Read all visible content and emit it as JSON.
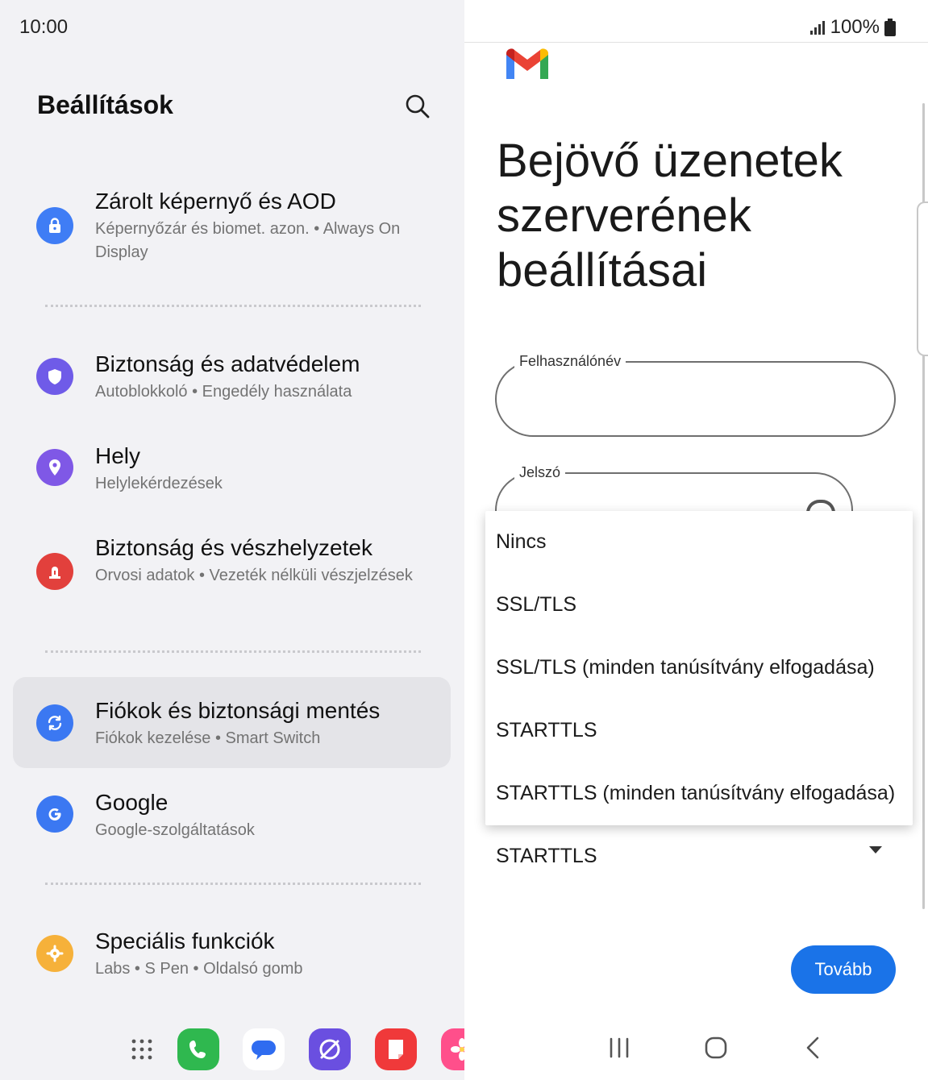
{
  "status_bar": {
    "time": "10:00",
    "battery": "100%"
  },
  "settings": {
    "title": "Beállítások",
    "items": [
      {
        "title": "Zárolt képernyő és AOD",
        "subtitle": "Képernyőzár és biomet. azon.  •  Always On Display",
        "icon": "lock-icon",
        "color": "#3f7df5"
      },
      {
        "title": "Biztonság és adatvédelem",
        "subtitle": "Autoblokkoló  •  Engedély használata",
        "icon": "shield-icon",
        "color": "#6f5be8"
      },
      {
        "title": "Hely",
        "subtitle": "Helylekérdezések",
        "icon": "location-pin-icon",
        "color": "#7f58e6"
      },
      {
        "title": "Biztonság és vészhelyzetek",
        "subtitle": "Orvosi adatok  •  Vezeték nélküli vészjelzések",
        "icon": "emergency-icon",
        "color": "#e2403c"
      },
      {
        "title": "Fiókok és biztonsági mentés",
        "subtitle": "Fiókok kezelése  •  Smart Switch",
        "icon": "sync-icon",
        "color": "#3b78f2"
      },
      {
        "title": "Google",
        "subtitle": "Google-szolgáltatások",
        "icon": "google-icon",
        "color": "#3b78f2"
      },
      {
        "title": "Speciális funkciók",
        "subtitle": "Labs  •  S Pen  •  Oldalsó gomb",
        "icon": "advanced-features-icon",
        "color": "#f6b13a"
      }
    ]
  },
  "gmail": {
    "heading": "Bejövő üzenetek szerverének beállításai",
    "username_label": "Felhasználónév",
    "username_value": "",
    "password_label": "Jelszó",
    "security_options": [
      "Nincs",
      "SSL/TLS",
      "SSL/TLS (minden tanúsítvány elfogadása)",
      "STARTTLS",
      "STARTTLS (minden tanúsítvány elfogadása)"
    ],
    "security_selected": "STARTTLS",
    "next_label": "Tovább"
  },
  "colors": {
    "accent": "#1a73e8",
    "left_bg": "#f2f2f5"
  }
}
